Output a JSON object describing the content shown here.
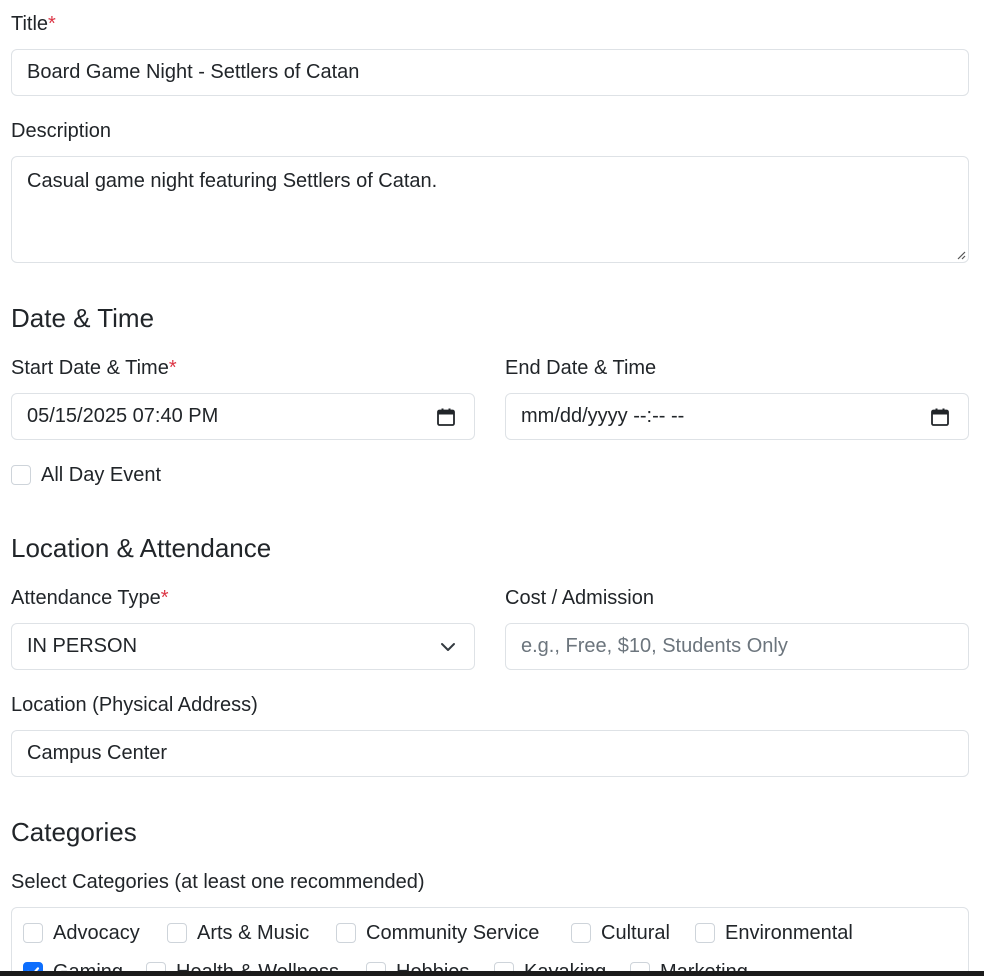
{
  "title_field": {
    "label": "Title",
    "required_mark": "*",
    "value": "Board Game Night - Settlers of Catan"
  },
  "description_field": {
    "label": "Description",
    "value": "Casual game night featuring Settlers of Catan."
  },
  "date_time": {
    "section_title": "Date & Time",
    "start": {
      "label": "Start Date & Time",
      "required_mark": "*",
      "value": "05/15/2025 07:40 PM",
      "icon": "calendar-icon"
    },
    "end": {
      "label": "End Date & Time",
      "value": "mm/dd/yyyy --:-- --",
      "icon": "calendar-icon"
    },
    "all_day": {
      "label": "All Day Event",
      "checked": false
    }
  },
  "location_attendance": {
    "section_title": "Location & Attendance",
    "attendance_type": {
      "label": "Attendance Type",
      "required_mark": "*",
      "selected": "IN PERSON",
      "icon": "chevron-down-icon"
    },
    "cost": {
      "label": "Cost / Admission",
      "placeholder": "e.g., Free, $10, Students Only"
    },
    "location": {
      "label": "Location (Physical Address)",
      "value": "Campus Center"
    }
  },
  "categories": {
    "section_title": "Categories",
    "select_label": "Select Categories (at least one recommended)",
    "items": [
      {
        "label": "Advocacy",
        "checked": false
      },
      {
        "label": "Arts & Music",
        "checked": false
      },
      {
        "label": "Community Service",
        "checked": false
      },
      {
        "label": "Cultural",
        "checked": false
      },
      {
        "label": "Environmental",
        "checked": false
      },
      {
        "label": "Gaming",
        "checked": true
      },
      {
        "label": "Health & Wellness",
        "checked": false
      },
      {
        "label": "Hobbies",
        "checked": false
      },
      {
        "label": "Kayaking",
        "checked": false
      },
      {
        "label": "Marketing",
        "checked": false
      }
    ]
  },
  "colors": {
    "accent": "#0d6efd",
    "required": "#dc3545",
    "border": "#dee2e6"
  }
}
